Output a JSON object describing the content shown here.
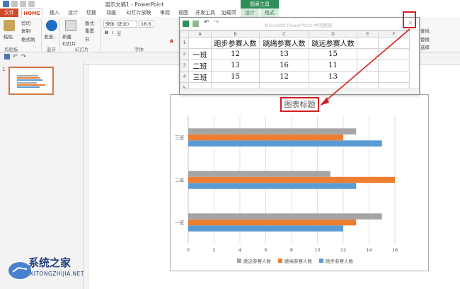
{
  "app": {
    "title": "演示文稿1 - PowerPoint",
    "context_tab_group": "图表工具"
  },
  "ribbon": {
    "tabs": [
      "文件",
      "HOME",
      "插入",
      "设计",
      "切换",
      "动画",
      "幻灯片放映",
      "审阅",
      "视图",
      "开发工具",
      "加载项",
      "设计",
      "格式"
    ],
    "paste_label": "粘贴",
    "cut_label": "剪切",
    "copy_label": "复制",
    "format_painter_label": "格式刷",
    "clipboard_group": "剪贴板",
    "bluetooth_label": "发送...",
    "bluetooth_group": "蓝牙",
    "new_slide_label": "新建\n幻灯片",
    "layout_label": "版式",
    "reset_label": "重置",
    "section_label": "节",
    "slides_group": "幻灯片",
    "font_name": "宋体 (正文)",
    "font_size": "18.6",
    "font_group": "字体",
    "right_labels": [
      "查找",
      "替换",
      "选择"
    ]
  },
  "thumbnail": {
    "number": "1"
  },
  "sheet": {
    "title": "Microsoft PowerPoint 中的图表",
    "close_glyph": "×",
    "columns": [
      "A",
      "B",
      "C",
      "D",
      "E",
      "F"
    ],
    "rows": [
      {
        "num": "1",
        "cells": [
          "",
          "跑步参赛人数",
          "跳绳参赛人数",
          "跳远参赛人数",
          "",
          ""
        ]
      },
      {
        "num": "2",
        "cells": [
          "一班",
          "12",
          "13",
          "15",
          "",
          ""
        ]
      },
      {
        "num": "3",
        "cells": [
          "二班",
          "13",
          "16",
          "11",
          "",
          ""
        ]
      },
      {
        "num": "4",
        "cells": [
          "三班",
          "15",
          "12",
          "13",
          "",
          ""
        ]
      },
      {
        "num": "5",
        "cells": [
          "",
          "",
          "",
          "",
          "",
          ""
        ]
      }
    ]
  },
  "chart_title": "图表标题",
  "colors": {
    "series1": "#5b9bd5",
    "series2": "#ed7d31",
    "series3": "#a5a5a5",
    "annotation": "#d31f1f",
    "accent": "#d24726"
  },
  "chart_data": {
    "type": "bar",
    "orientation": "horizontal",
    "title": "图表标题",
    "categories": [
      "一班",
      "二班",
      "三班"
    ],
    "series": [
      {
        "name": "跑步参赛人数",
        "values": [
          12,
          13,
          15
        ]
      },
      {
        "name": "跳绳参赛人数",
        "values": [
          13,
          16,
          12
        ]
      },
      {
        "name": "跳远参赛人数",
        "values": [
          15,
          11,
          13
        ]
      }
    ],
    "xlim": [
      0,
      16
    ],
    "xticks": [
      "0",
      "2",
      "4",
      "6",
      "8",
      "10",
      "12",
      "14",
      "16"
    ],
    "grid": true,
    "legend_position": "bottom",
    "legend_order": [
      "跳远参赛人数",
      "跳绳参赛人数",
      "跑步参赛人数"
    ]
  },
  "watermark": {
    "text": "系统之家",
    "url": "XITONGZHIJIA.NET"
  }
}
